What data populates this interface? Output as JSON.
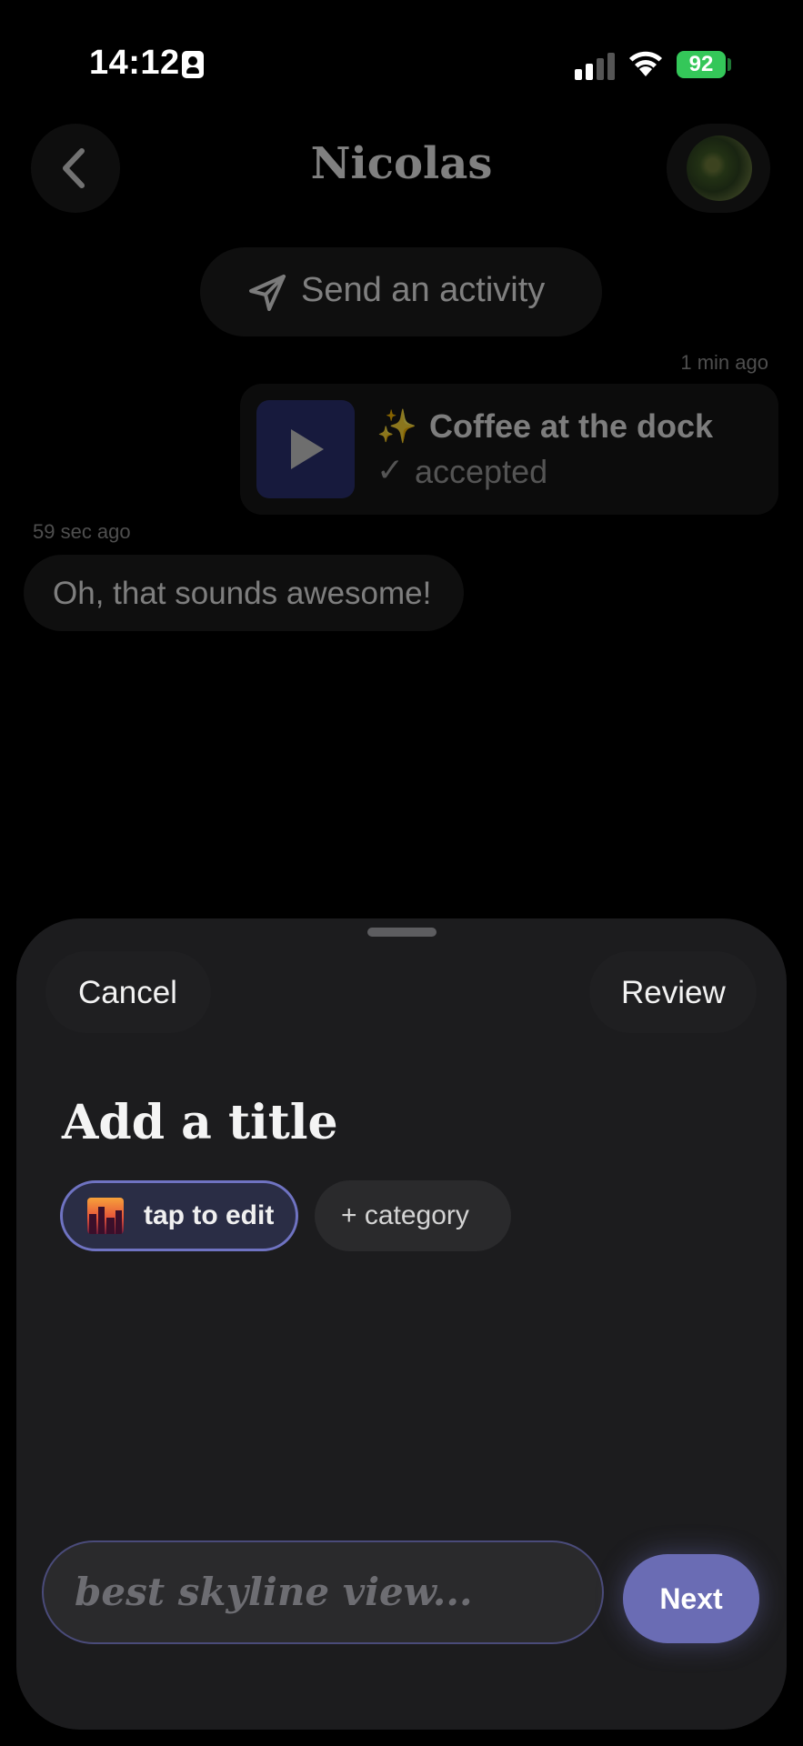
{
  "status_bar": {
    "time": "14:12",
    "battery": "92"
  },
  "header": {
    "title": "Nicolas"
  },
  "send_activity": {
    "label": "Send an activity"
  },
  "messages": [
    {
      "timestamp": "1 min ago",
      "type": "activity",
      "emoji": "✨",
      "title": "Coffee at the dock",
      "check": "✓",
      "status": "accepted"
    },
    {
      "timestamp": "59 sec ago",
      "type": "text",
      "text": "Oh, that sounds awesome!"
    }
  ],
  "sheet": {
    "cancel_label": "Cancel",
    "review_label": "Review",
    "heading": "Add a title",
    "chips": [
      {
        "label": "tap to edit"
      },
      {
        "label": "+ category"
      }
    ],
    "input_placeholder": "best skyline view...",
    "next_label": "Next"
  },
  "colors": {
    "accent": "#6a6cb4",
    "battery": "#34c759",
    "sparkle": "#e6b53b"
  }
}
